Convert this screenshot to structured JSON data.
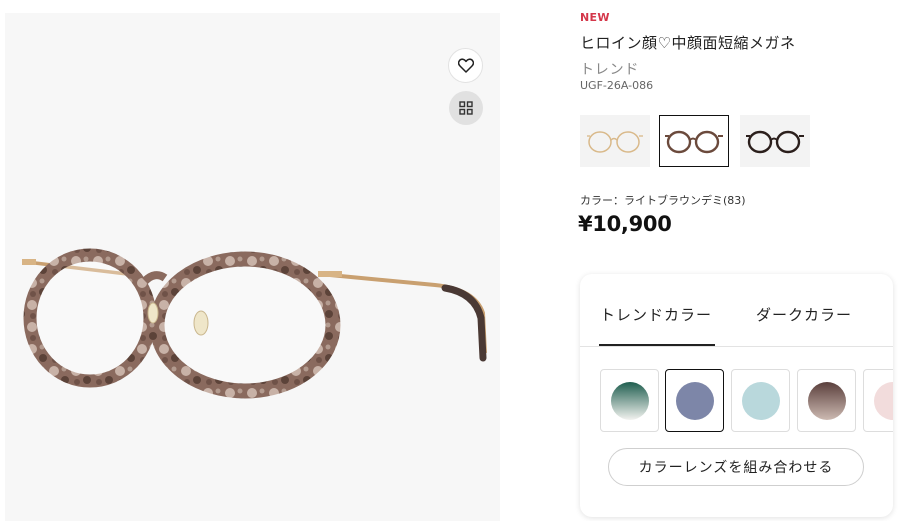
{
  "product": {
    "badge": "NEW",
    "title": "ヒロイン顔♡中顔面短縮メガネ",
    "subtitle": "トレンド",
    "code": "UGF-26A-086",
    "color_label": "カラー：ライトブラウンデミ(83)",
    "price": "¥10,900"
  },
  "image_actions": {
    "favorite_icon": "heart-icon",
    "gallery_icon": "grid-icon"
  },
  "frame_colors": [
    {
      "name": "light-gold-frame",
      "selected": false,
      "color": "#d9b98a"
    },
    {
      "name": "light-brown-demi-frame",
      "selected": true,
      "color": "#6b4a3c"
    },
    {
      "name": "dark-brown-frame",
      "selected": false,
      "color": "#2b1f1c"
    }
  ],
  "lens_panel": {
    "tabs": [
      {
        "label": "トレンドカラー",
        "active": true
      },
      {
        "label": "ダークカラー",
        "active": false
      }
    ],
    "swatches": [
      {
        "color_top": "#1f5e4f",
        "color_bottom": "#f3f3f0",
        "selected": false
      },
      {
        "color_top": "#7d86a8",
        "color_bottom": "#7d86a8",
        "selected": true
      },
      {
        "color_top": "#b9d8dc",
        "color_bottom": "#b9d8dc",
        "selected": false
      },
      {
        "color_top": "#5a3f3c",
        "color_bottom": "#cdbab2",
        "selected": false
      },
      {
        "color_top": "#f2dcdc",
        "color_bottom": "#f2dcdc",
        "selected": false
      }
    ],
    "combine_button": "カラーレンズを組み合わせる"
  }
}
